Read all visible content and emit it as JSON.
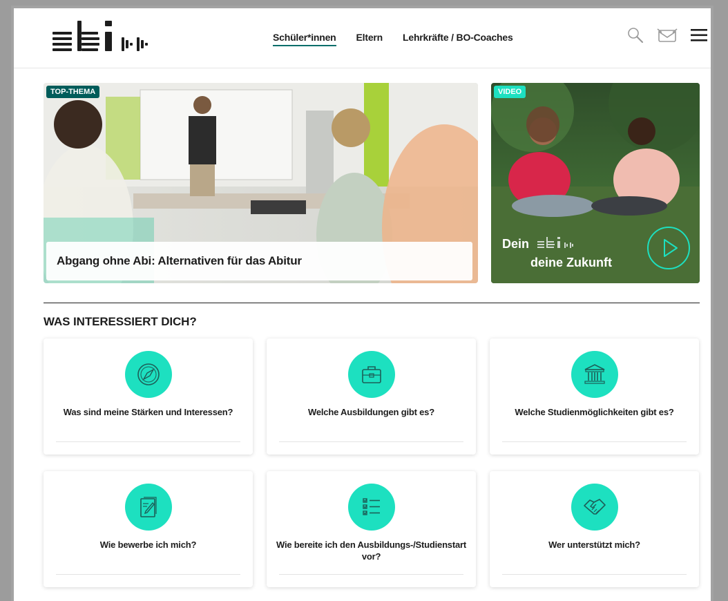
{
  "nav": {
    "items": [
      {
        "label": "Schüler*innen"
      },
      {
        "label": "Eltern"
      },
      {
        "label": "Lehrkräfte / BO-Coaches"
      }
    ]
  },
  "header_icons": [
    "search-icon",
    "handshake-mail-icon",
    "menu-icon"
  ],
  "teaser_main": {
    "tag": "TOP-THEMA",
    "title": "Abgang ohne Abi: Alternativen für das Abitur"
  },
  "teaser_video": {
    "tag": "VIDEO",
    "line1_prefix": "Dein",
    "line2": "deine Zukunft"
  },
  "section": {
    "title": "WAS INTERESSIERT DICH?"
  },
  "cards": [
    {
      "label": "Was sind meine Stärken und Interessen?",
      "icon": "compass-icon"
    },
    {
      "label": "Welche Ausbildungen gibt es?",
      "icon": "toolbox-icon"
    },
    {
      "label": "Welche Studienmöglichkeiten gibt es?",
      "icon": "university-icon"
    },
    {
      "label": "Wie bewerbe ich mich?",
      "icon": "document-edit-icon"
    },
    {
      "label": "Wie bereite ich den Ausbildungs-/Studienstart vor?",
      "icon": "checklist-icon"
    },
    {
      "label": "Wer unterstützt mich?",
      "icon": "handshake-icon"
    }
  ],
  "colors": {
    "accent": "#1de0c0",
    "dark_teal": "#005c5a",
    "text": "#1d1d1d"
  }
}
